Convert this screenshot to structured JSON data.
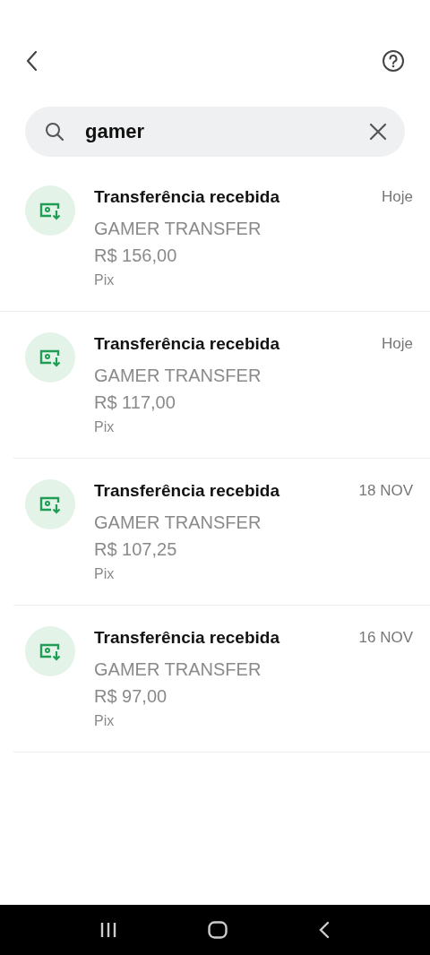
{
  "search": {
    "value": "gamer"
  },
  "transactions": [
    {
      "title": "Transferência recebida",
      "name": "GAMER TRANSFER",
      "amount": "R$ 156,00",
      "method": "Pix",
      "date": "Hoje"
    },
    {
      "title": "Transferência recebida",
      "name": "GAMER TRANSFER",
      "amount": "R$ 117,00",
      "method": "Pix",
      "date": "Hoje"
    },
    {
      "title": "Transferência recebida",
      "name": "GAMER TRANSFER",
      "amount": "R$ 107,25",
      "method": "Pix",
      "date": "18 NOV"
    },
    {
      "title": "Transferência recebida",
      "name": "GAMER TRANSFER",
      "amount": "R$ 97,00",
      "method": "Pix",
      "date": "16 NOV"
    }
  ]
}
